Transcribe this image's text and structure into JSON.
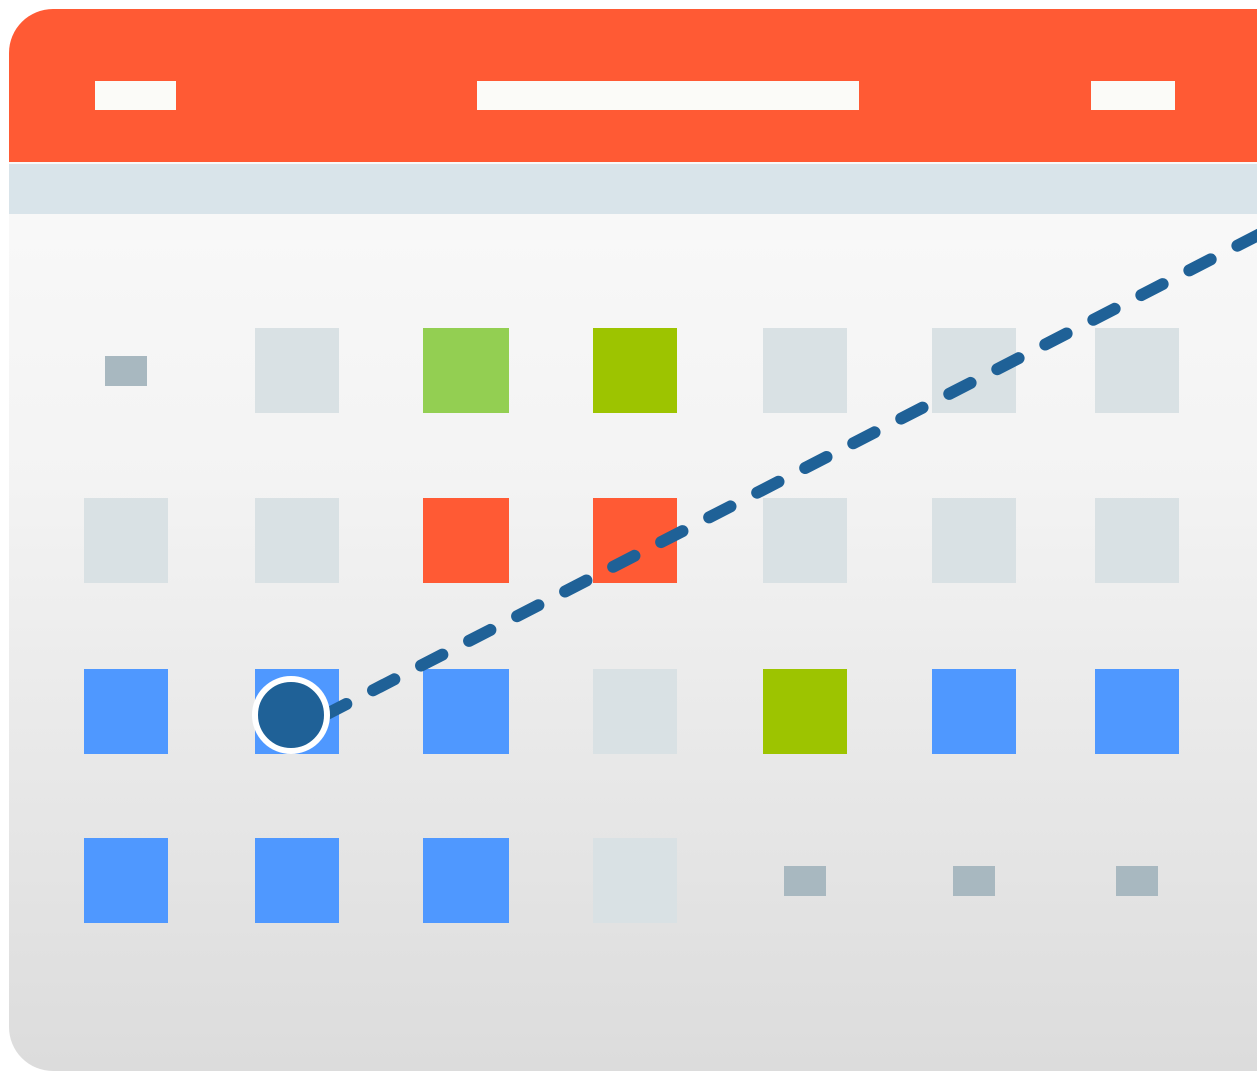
{
  "icon": {
    "name": "calendar-icon",
    "colors": {
      "header": "#ff5a34",
      "header_bar": "#fbfbf8",
      "weekday_strip": "#d9e4ea",
      "empty_day": "#d9e1e4",
      "inactive_marker": "#a8b8c0",
      "light_green": "#93cf52",
      "green": "#9dc400",
      "red": "#ff5a34",
      "blue": "#4f98ff",
      "trend_line": "#1f6197"
    },
    "rows": [
      [
        "inactive",
        "empty",
        "light_green",
        "green",
        "empty",
        "empty",
        "empty"
      ],
      [
        "empty",
        "empty",
        "red",
        "red",
        "empty",
        "empty",
        "empty"
      ],
      [
        "blue",
        "blue",
        "blue",
        "empty",
        "green",
        "blue",
        "blue"
      ],
      [
        "blue",
        "blue",
        "blue",
        "empty",
        "inactive",
        "inactive",
        "inactive"
      ]
    ],
    "highlighted_day": {
      "row": 3,
      "column": 2
    }
  }
}
